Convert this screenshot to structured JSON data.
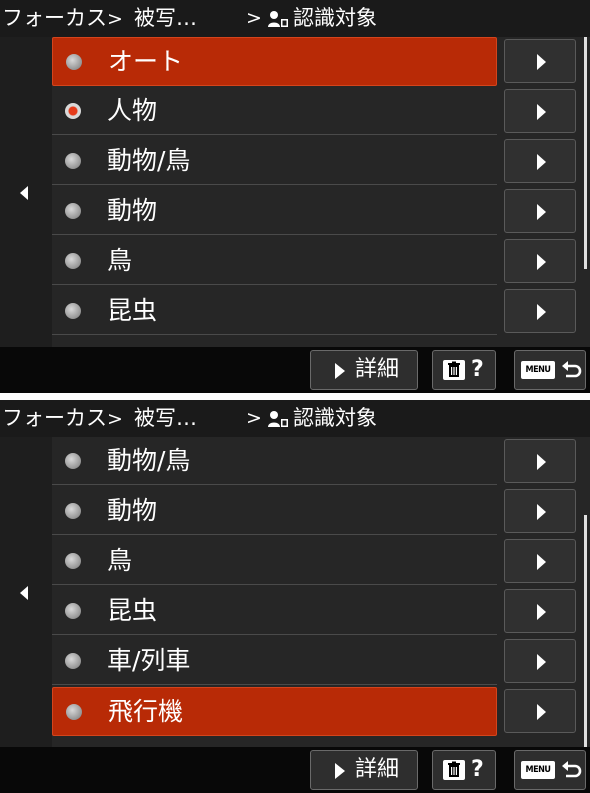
{
  "screens": [
    {
      "breadcrumb": {
        "section": "フォーカス",
        "subsection": "被写…",
        "page": "認識対象",
        "separator": ">"
      },
      "items": [
        {
          "label": "オート",
          "radio_selected": false,
          "highlighted": true
        },
        {
          "label": "人物",
          "radio_selected": true,
          "highlighted": false
        },
        {
          "label": "動物/鳥",
          "radio_selected": false,
          "highlighted": false
        },
        {
          "label": "動物",
          "radio_selected": false,
          "highlighted": false
        },
        {
          "label": "鳥",
          "radio_selected": false,
          "highlighted": false
        },
        {
          "label": "昆虫",
          "radio_selected": false,
          "highlighted": false
        }
      ],
      "scroll_position": 0.0
    },
    {
      "breadcrumb": {
        "section": "フォーカス",
        "subsection": "被写…",
        "page": "認識対象",
        "separator": ">"
      },
      "items": [
        {
          "label": "動物/鳥",
          "radio_selected": false,
          "highlighted": false
        },
        {
          "label": "動物",
          "radio_selected": false,
          "highlighted": false
        },
        {
          "label": "鳥",
          "radio_selected": false,
          "highlighted": false
        },
        {
          "label": "昆虫",
          "radio_selected": false,
          "highlighted": false
        },
        {
          "label": "車/列車",
          "radio_selected": false,
          "highlighted": false
        },
        {
          "label": "飛行機",
          "radio_selected": false,
          "highlighted": true
        }
      ],
      "scroll_position": 1.0
    }
  ],
  "footer": {
    "detail_label": "詳細",
    "delete_help_label": "?",
    "menu_label": "MENU"
  },
  "colors": {
    "highlight": "#b82a06",
    "radio_on": "#e53b1a",
    "background": "#262626"
  },
  "icons": {
    "left_nav": "triangle-left-icon",
    "submenu": "triangle-right-icon",
    "subject": "person-icon",
    "delete": "trash-icon",
    "back": "return-arrow-icon"
  }
}
